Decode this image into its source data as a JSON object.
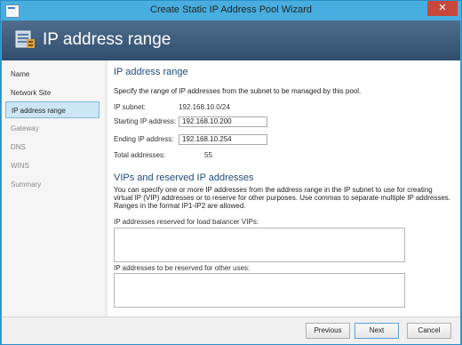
{
  "window": {
    "title": "Create Static IP Address Pool Wizard",
    "close_glyph": "✕"
  },
  "header": {
    "title": "IP address range",
    "icon": "server-network-icon"
  },
  "nav": {
    "items": [
      {
        "label": "Name",
        "state": "normal"
      },
      {
        "label": "Network Site",
        "state": "normal"
      },
      {
        "label": "IP address range",
        "state": "selected"
      },
      {
        "label": "Gateway",
        "state": "disabled"
      },
      {
        "label": "DNS",
        "state": "disabled"
      },
      {
        "label": "WINS",
        "state": "disabled"
      },
      {
        "label": "Summary",
        "state": "disabled"
      }
    ]
  },
  "range": {
    "heading": "IP address range",
    "description": "Specify the range of IP addresses from the subnet to be managed by this pool.",
    "subnet_label": "IP subnet:",
    "subnet_value": "192.168.10.0/24",
    "start_label": "Starting IP address:",
    "start_value": "192.168.10.200",
    "end_label": "Ending IP address:",
    "end_value": "192.168.10.254",
    "total_label": "Total addresses:",
    "total_value": "55"
  },
  "vips": {
    "heading": "VIPs and reserved IP addresses",
    "description": "You can specify one or more IP addresses from the address range in the IP subnet to use for creating virtual IP (VIP) addresses or to reserve for other purposes. Use commas to separate multiple IP addresses. Ranges in the format IP1-IP2 are allowed.",
    "lb_label": "IP addresses reserved for load balancer VIPs:",
    "lb_value": "",
    "other_label": "IP addresses to be reserved for other uses:",
    "other_value": ""
  },
  "footer": {
    "previous": "Previous",
    "next": "Next",
    "cancel": "Cancel"
  }
}
